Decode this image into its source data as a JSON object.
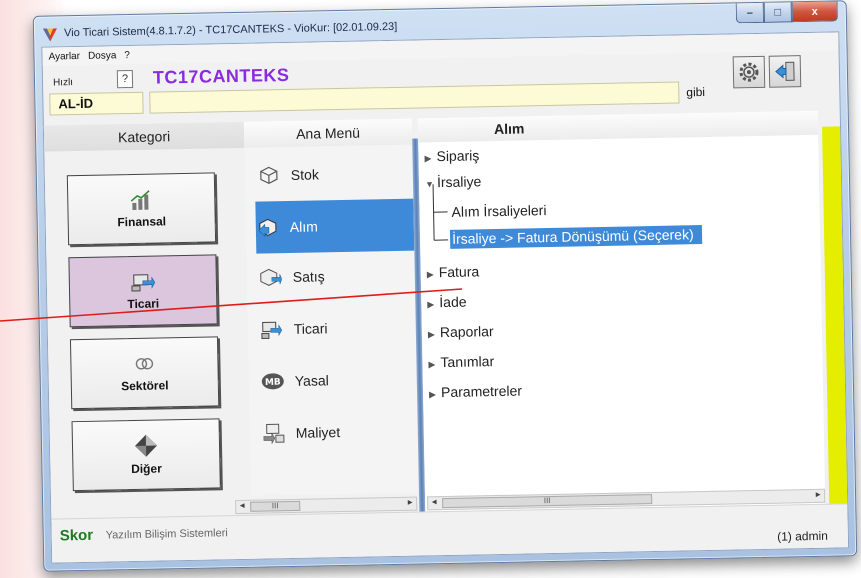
{
  "window": {
    "title": "Vio Ticari Sistem(4.8.1.7.2)  - TC17CANTEKS - VioKur: [02.01.09.23]",
    "controls": {
      "minimize": "–",
      "maximize": "□",
      "close": "x"
    }
  },
  "menubar": {
    "items": [
      "Ayarlar",
      "Dosya",
      "?"
    ]
  },
  "header": {
    "quick_label": "Hızlı",
    "help_icon_text": "?",
    "company": "TC17CANTEKS",
    "code": "AL-İD",
    "search_value": "",
    "search_suffix": "gibi"
  },
  "columns": {
    "kategori": "Kategori",
    "ana_menu": "Ana Menü",
    "alim": "Alım"
  },
  "categories": [
    {
      "label": "Finansal",
      "icon": "chart-icon",
      "active": false
    },
    {
      "label": "Ticari",
      "icon": "trade-icon",
      "active": true
    },
    {
      "label": "Sektörel",
      "icon": "rings-icon",
      "active": false
    },
    {
      "label": "Diğer",
      "icon": "diamond-icon",
      "active": false
    }
  ],
  "main_menu": [
    {
      "label": "Stok",
      "icon": "cube-icon",
      "selected": false
    },
    {
      "label": "Alım",
      "icon": "box-arrow-icon",
      "selected": true
    },
    {
      "label": "Satış",
      "icon": "sales-icon",
      "selected": false
    },
    {
      "label": "Ticari",
      "icon": "trade-icon",
      "selected": false
    },
    {
      "label": "Yasal",
      "icon": "mb-icon",
      "selected": false
    },
    {
      "label": "Maliyet",
      "icon": "cost-icon",
      "selected": false
    }
  ],
  "tree": {
    "siparis": "Sipariş",
    "irsaliye": "İrsaliye",
    "alim_irsaliyeleri": "Alım İrsaliyeleri",
    "donusum": "İrsaliye -> Fatura Dönüşümü (Seçerek)",
    "fatura": "Fatura",
    "iade": "İade",
    "raporlar": "Raporlar",
    "tanimlar": "Tanımlar",
    "parametreler": "Parametreler"
  },
  "scrollbars": {
    "thumb": "III",
    "left_arrow": "◄",
    "right_arrow": "►"
  },
  "status": {
    "brand": "Skor",
    "brand_sub": "Yazılım Bilişim Sistemleri",
    "user": "(1) admin"
  },
  "colors": {
    "selection": "#3f8ad8",
    "company": "#8a2be2",
    "brand": "#1f7a1f",
    "active_category": "#dcc6de",
    "side_bar": "#e6ee00",
    "annotation_line": "#e01b1b"
  }
}
